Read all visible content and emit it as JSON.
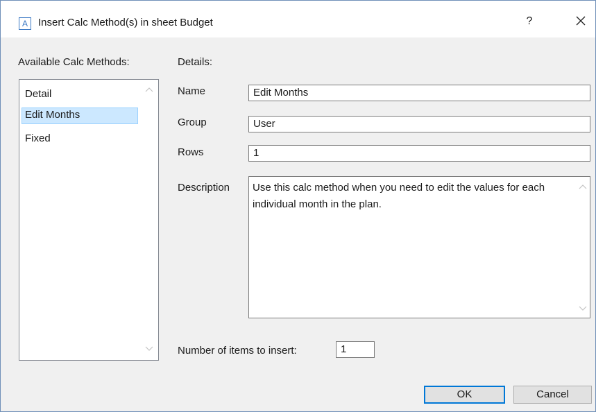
{
  "window": {
    "title": "Insert Calc Method(s) in sheet Budget",
    "app_icon_letter": "A",
    "help_label": "?"
  },
  "available": {
    "label": "Available Calc Methods:",
    "items": [
      {
        "label": "Detail",
        "selected": false
      },
      {
        "label": "Edit Months",
        "selected": true
      },
      {
        "label": "Fixed",
        "selected": false
      }
    ]
  },
  "details": {
    "label": "Details:",
    "name_label": "Name",
    "name_value": "Edit Months",
    "group_label": "Group",
    "group_value": "User",
    "rows_label": "Rows",
    "rows_value": "1",
    "description_label": "Description",
    "description_value": "Use this calc method when you need to edit the values for each individual month in the plan."
  },
  "insert": {
    "label": "Number of items to insert:",
    "value": "1"
  },
  "buttons": {
    "ok_label": "OK",
    "cancel_label": "Cancel"
  }
}
